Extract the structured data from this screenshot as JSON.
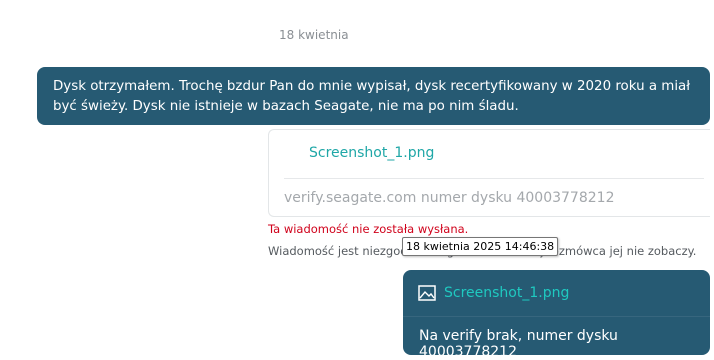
{
  "conversation": {
    "date_separator": "18 kwietnia",
    "incoming_message": {
      "text": "Dysk otrzymałem. Trochę bzdur Pan do mnie wypisał, dysk recertyfikowany w 2020 roku a miał być świeży. Dysk nie istnieje w bazach Seagate, nie ma po nim śladu."
    },
    "attachment_card": {
      "file_name": "Screenshot_1.png",
      "caption": "verify.seagate.com numer dysku 40003778212"
    },
    "status": {
      "error": "Ta wiadomość nie została wysłana.",
      "info": "Wiadomość jest niezgodna z regulaminem. Twój rozmówca jej nie zobaczy."
    },
    "tooltip": "18 kwietnia 2025 14:46:38",
    "reply_message": {
      "file_name": "Screenshot_1.png",
      "icon": "image-icon",
      "text": "Na verify brak, numer dysku 40003778212"
    }
  },
  "colors": {
    "bubble": "#265a73",
    "link": "#1fa7a7",
    "link_on_dark": "#1fc9c0",
    "error": "#d0021b"
  }
}
